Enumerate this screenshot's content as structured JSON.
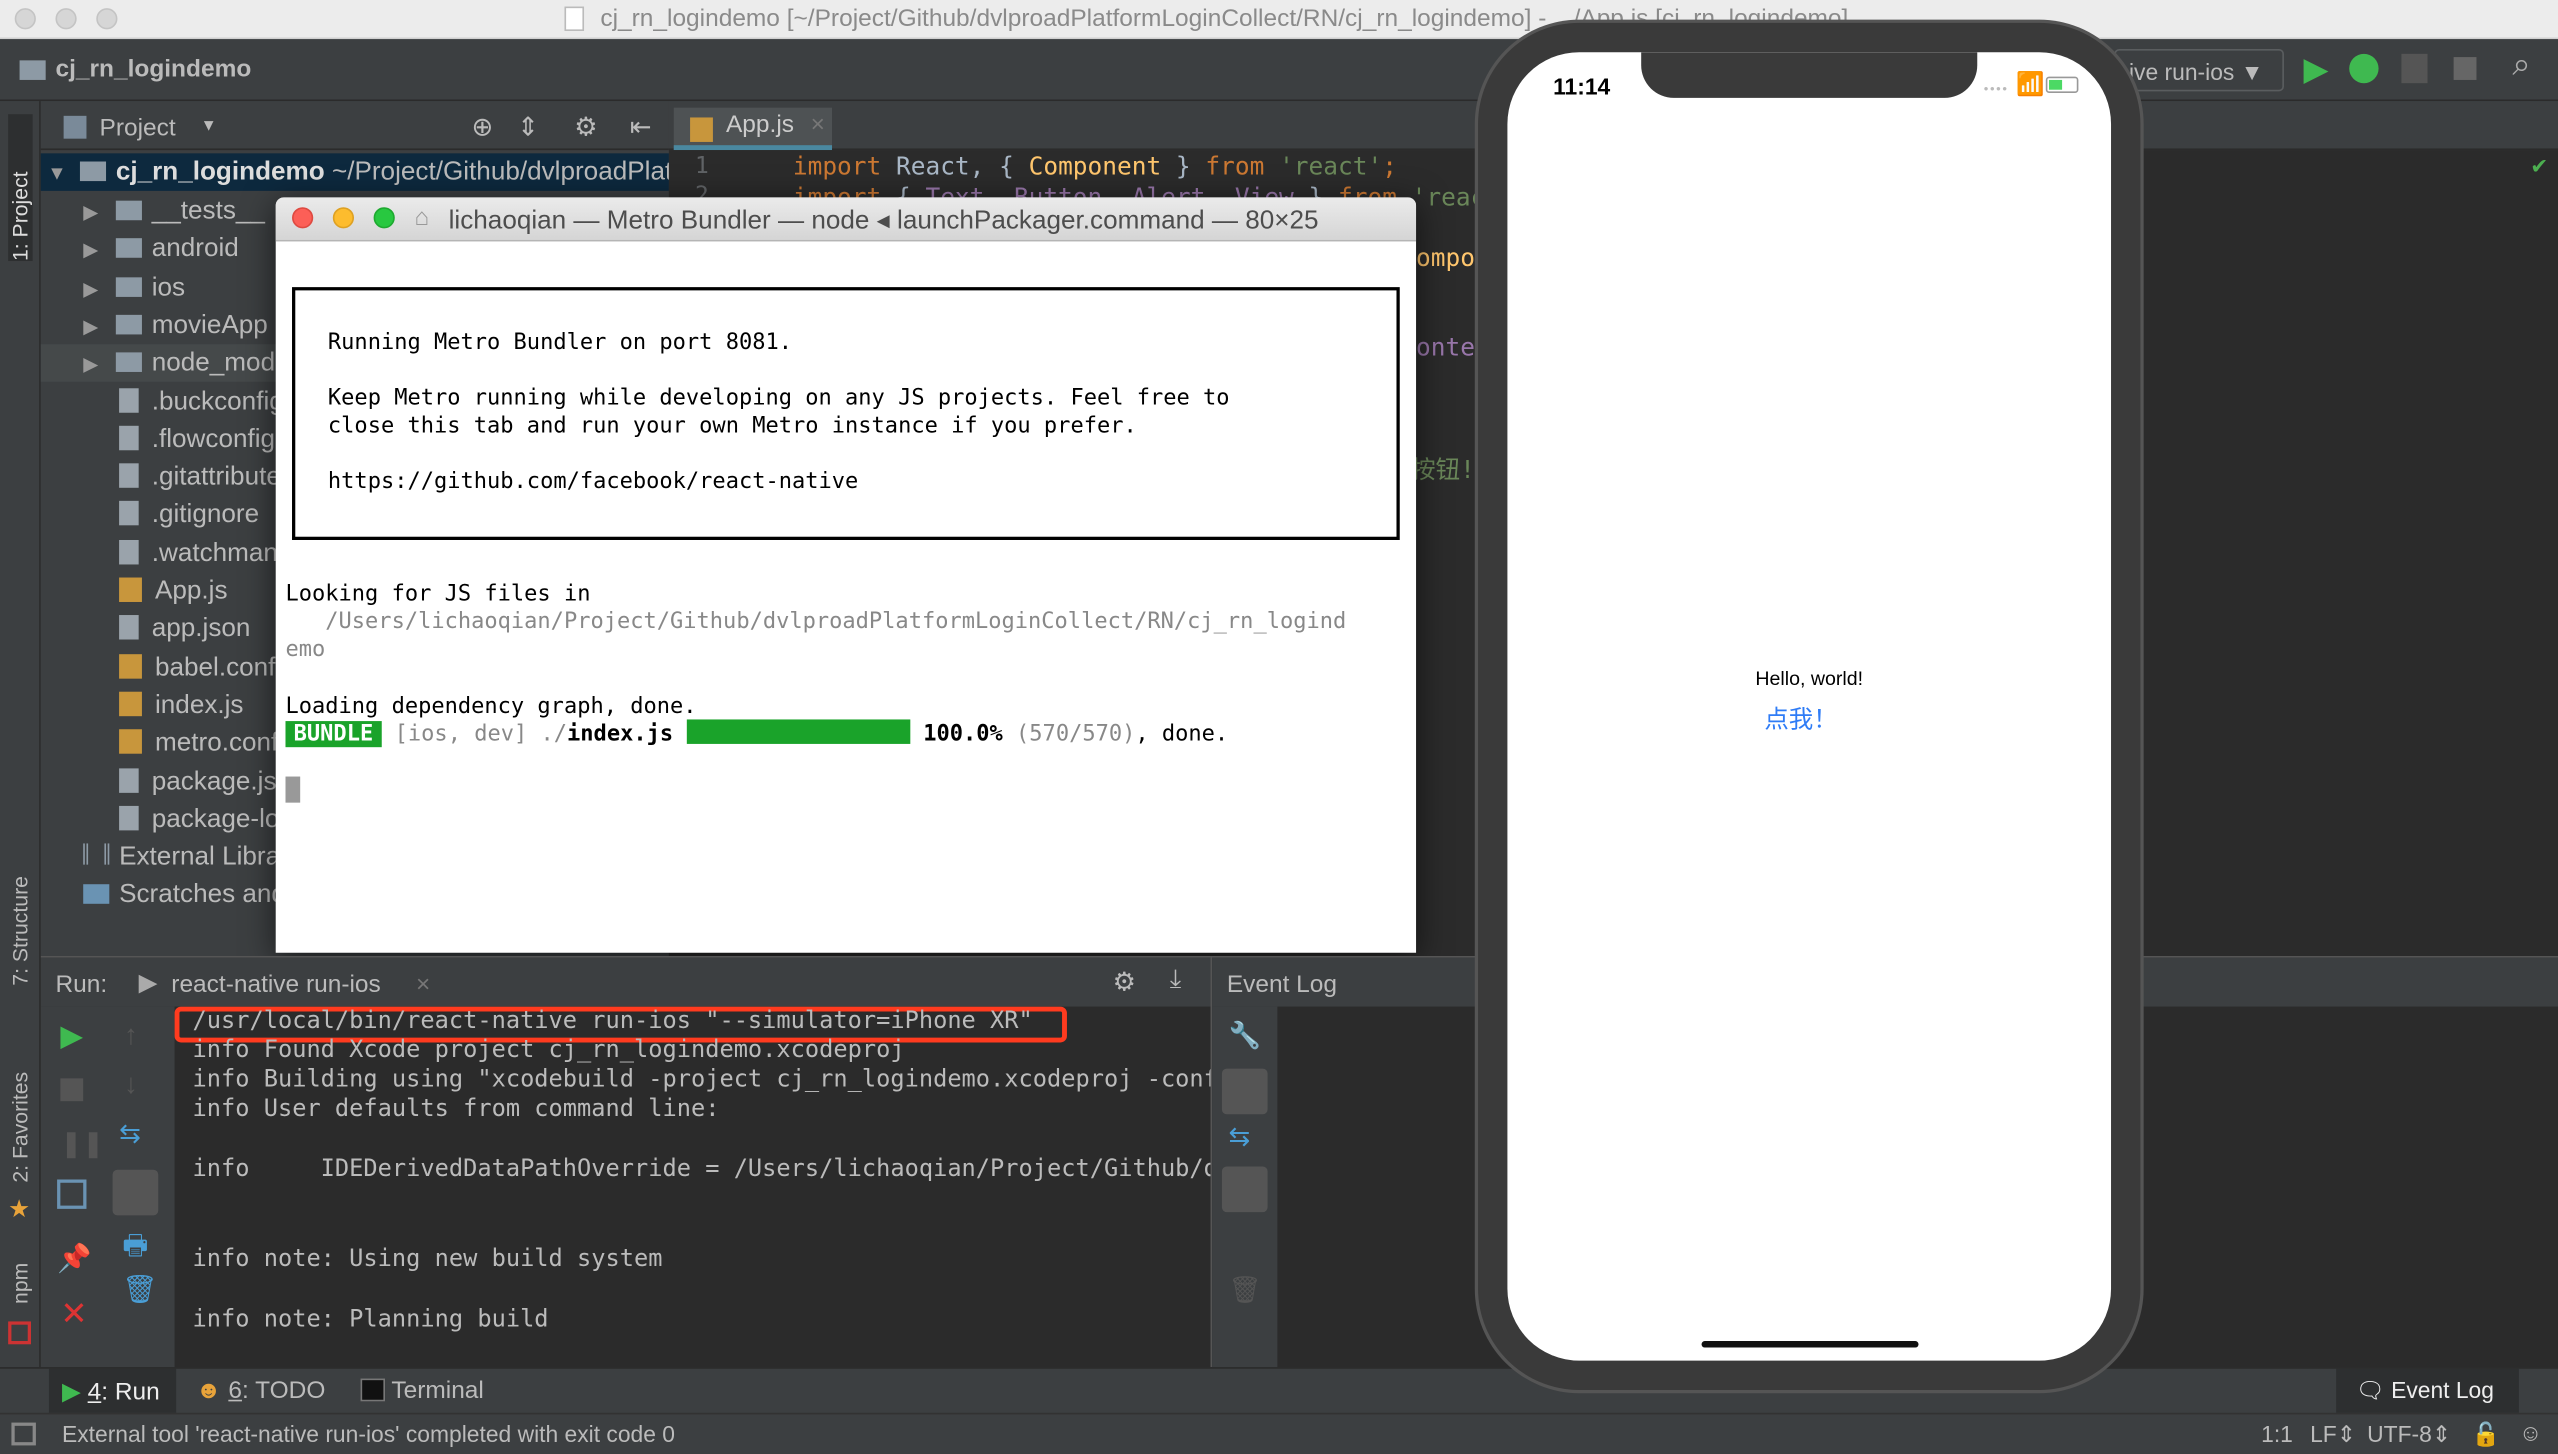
{
  "window": {
    "title": "cj_rn_logindemo [~/Project/Github/dvlproadPlatformLoginCollect/RN/cj_rn_logindemo] - .../App.js [cj_rn_logindemo]"
  },
  "navbar": {
    "breadcrumb": "cj_rn_logindemo",
    "run_config": "ive run-ios"
  },
  "left_strip": {
    "project": "1: Project",
    "structure": "7: Structure",
    "favorites": "2: Favorites",
    "npm": "npm"
  },
  "project_panel": {
    "title": "Project",
    "root": {
      "name": "cj_rn_logindemo",
      "path": "~/Project/Github/dvlproadPlatformLoginCollect/RN/cj_rn_logindemo"
    },
    "items": [
      {
        "name": "__tests__",
        "type": "folder"
      },
      {
        "name": "android",
        "type": "folder"
      },
      {
        "name": "ios",
        "type": "folder"
      },
      {
        "name": "movieApp",
        "type": "folder"
      },
      {
        "name": "node_modules",
        "type": "folder"
      },
      {
        "name": ".buckconfig",
        "type": "file"
      },
      {
        "name": ".flowconfig",
        "type": "file"
      },
      {
        "name": ".gitattributes",
        "type": "file"
      },
      {
        "name": ".gitignore",
        "type": "file"
      },
      {
        "name": ".watchmanconfig",
        "type": "file"
      },
      {
        "name": "App.js",
        "type": "js"
      },
      {
        "name": "app.json",
        "type": "file"
      },
      {
        "name": "babel.config.js",
        "type": "js"
      },
      {
        "name": "index.js",
        "type": "js"
      },
      {
        "name": "metro.config.js",
        "type": "js"
      },
      {
        "name": "package.json",
        "type": "file"
      },
      {
        "name": "package-lock.json",
        "type": "file"
      }
    ],
    "external": "External Libraries",
    "scratches": "Scratches and Consoles"
  },
  "editor": {
    "tab": "App.js",
    "line_numbers": [
      "1",
      "2"
    ],
    "line1": {
      "k1": "import",
      "t1": " React, { ",
      "c1": "Component",
      "t2": " } ",
      "k2": "from",
      "s1": " 'react'",
      "p": ";"
    },
    "line2": {
      "k1": "import",
      "t1": " { ",
      "p1": "Text, Button, Alert, View",
      "t2": " } ",
      "k2": "from",
      "s1": " 'react-native';"
    },
    "fragments": [
      "ompon",
      "onten",
      "按钮!"
    ]
  },
  "terminal": {
    "title": "lichaoqian — Metro Bundler — node ◂ launchPackager.command — 80×25",
    "box": [
      "Running Metro Bundler on port 8081.",
      "Keep Metro running while developing on any JS projects. Feel free to",
      "close this tab and run your own Metro instance if you prefer.",
      "https://github.com/facebook/react-native"
    ],
    "looking": "Looking for JS files in",
    "path1": "   /Users/lichaoqian/Project/Github/dvlproadPlatformLoginCollect/RN/cj_rn_logind",
    "path2": "emo",
    "loading": "Loading dependency graph, done.",
    "bundle_badge": "BUNDLE",
    "bundle_meta": " [ios, dev] ./",
    "bundle_file": "index.js",
    "progress_percent": 100,
    "percent_text": "100.0%",
    "count": " (570/570)",
    "done": ", done."
  },
  "run_panel": {
    "label": "Run:",
    "tab": "react-native run-ios",
    "lines": [
      "/usr/local/bin/react-native run-ios \"--simulator=iPhone XR\"",
      "info Found Xcode project cj_rn_logindemo.xcodeproj",
      "info Building using \"xcodebuild -project cj_rn_logindemo.xcodeproj -configuration Debug",
      "info User defaults from command line:",
      "info     IDEDerivedDataPathOverride = /Users/lichaoqian/Project/Github/dvlproadPlatformLoginCollect",
      "info note: Using new build system",
      "info note: Planning build"
    ],
    "highlight_color": "#ff3b1f"
  },
  "event_log": {
    "title": "Event Log"
  },
  "bottom_tabs": [
    {
      "num": "4",
      "label": ": Run"
    },
    {
      "num": "6",
      "label": ": TODO"
    },
    {
      "label": "Terminal"
    }
  ],
  "event_log_button": "Event Log",
  "status": {
    "message": "External tool 'react-native run-ios' completed with exit code 0",
    "position": "1:1",
    "line_sep": "LF",
    "encoding": "UTF-8"
  },
  "phone": {
    "time": "11:14",
    "hello": "Hello, world!",
    "button": "点我！",
    "button_color": "#2f7cf6"
  },
  "colors": {
    "accent": "#4a88a0",
    "run_green": "#3fb950",
    "bundle_green": "#1aa32a"
  }
}
